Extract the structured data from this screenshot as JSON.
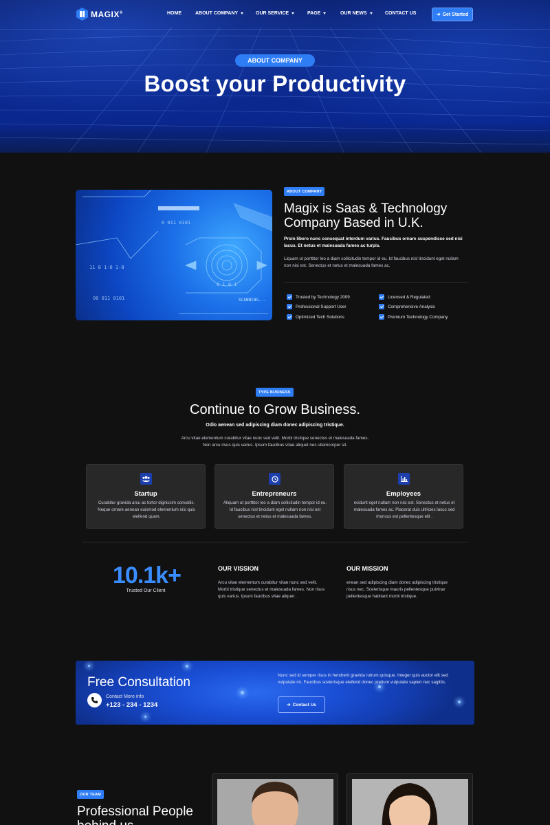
{
  "brand": {
    "name": "MAGIX",
    "mark": "®"
  },
  "nav": {
    "items": [
      {
        "label": "HOME",
        "dropdown": false
      },
      {
        "label": "ABOUT COMPANY",
        "dropdown": true
      },
      {
        "label": "OUR SERVICE",
        "dropdown": true
      },
      {
        "label": "PAGE",
        "dropdown": true
      },
      {
        "label": "OUR NEWS",
        "dropdown": true
      },
      {
        "label": "CONTACT US",
        "dropdown": false
      }
    ],
    "cta": "Get Started"
  },
  "hero": {
    "pill": "ABOUT COMPANY",
    "title": "Boost your Productivity"
  },
  "about": {
    "tag": "ABOUT COMPANY",
    "title": "Magix is Saas & Technology Company Based in U.K.",
    "bold": "Proin libero nunc consequat interdum varius. Faucibus ornare suspendisse sed nisi lacus. Et netus et malesuada fames ac turpis.",
    "text": "Liquam ut porttitor leo a diam sollicitudin tempor id eu. Id faucibus nisl tincidunt eget nullam non nisi est. Senectus et netus et malesuada fames ac.",
    "checks": [
      "Trusted by Technology 2009",
      "Licensed & Regulated",
      "Professional Support User",
      "Comprehensive Analysis",
      "Optimized Tech Solutions",
      "Premium Technology Company"
    ],
    "image_texts": {
      "scanning": "SCANNING..."
    }
  },
  "business": {
    "tag": "TYPE BUSINESS",
    "title": "Continue to Grow Business.",
    "bold": "Odio aenean sed adipiscing diam donec adipiscing tristique.",
    "text": "Arcu vitae elementum curabitur vitae nunc sed velit. Morbi tristique senectus et malesuada fames. Non arcu risus quis varius. Ipsum faucibus vitae aliquet nec ullamcorper sit.",
    "cards": [
      {
        "title": "Startup",
        "icon": "people-icon",
        "text": "Curabitur gravida arcu ac tortor dignissim convallis. Neque ornare aenean euismod elementum nisi quis eleifend quam."
      },
      {
        "title": "Entrepreneurs",
        "icon": "clock-icon",
        "text": "Aliquam ut porttitor leo a diam sollicitudin tempor id eu. Id faucibus nisl tincidunt eget nullam non nisi est senectus et netus et malesuada fames."
      },
      {
        "title": "Employees",
        "icon": "chart-icon",
        "text": "ncidunt eget nullam non nisi est. Senectus et netus et malesuada fames ac. Placerat duis ultricies lacus sed rhoncus est pellentesque elit ."
      }
    ]
  },
  "stats": {
    "value": "10.1k+",
    "label": "Trusted Our Client",
    "vision": {
      "title": "OUR VISSION",
      "text": "Arcu vitae elementum curabitur vitae nunc sed velit. Morbi tristique senectus et malesuada fames. Non risus quis varius. Ipsum faucibus vitae aliquet ."
    },
    "mission": {
      "title": "OUR MISSION",
      "text": "enean sed adipiscing diam donec adipiscing tristique risus nec. Scelerisque mauris pellentesque pulvinar pellentesque habitant morbi tristique."
    }
  },
  "consultation": {
    "title": "Free Consultation",
    "contact_label": "Contact More info",
    "phone": "+123 - 234 - 1234",
    "text": "Nunc sed id semper risus in hendrerit gravida rutrum quisque. Integer quis auctor elit sed vulputate mi. Faucibus scelerisque eleifend donec pretium vulputate sapien nec sagittis.",
    "button": "Contact Us"
  },
  "team": {
    "tag": "OUR TEAM",
    "title": "Professional People behind us"
  },
  "colors": {
    "accent": "#2f7df5",
    "background": "#111111",
    "card": "#282828",
    "stat": "#3a8dff"
  }
}
